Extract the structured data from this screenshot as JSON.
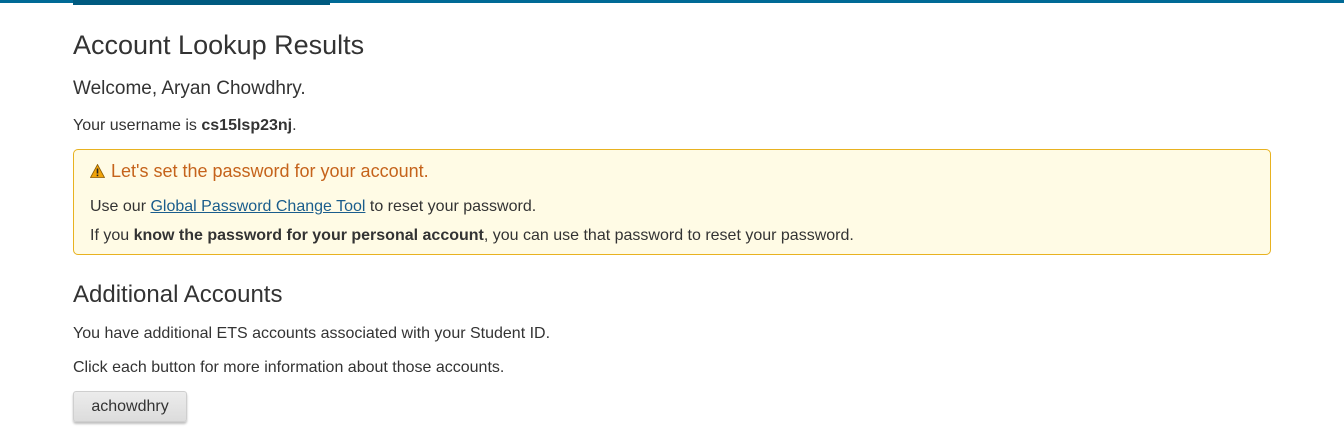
{
  "page": {
    "title": "Account Lookup Results",
    "welcome": "Welcome, Aryan Chowdhry.",
    "username_prefix": "Your username is ",
    "username": "cs15lsp23nj",
    "username_suffix": "."
  },
  "alert": {
    "icon": "warning-icon",
    "title": "Let's set the password for your account.",
    "line1_prefix": "Use our ",
    "line1_link": "Global Password Change Tool",
    "line1_suffix": " to reset your password.",
    "line2_prefix": "If you ",
    "line2_bold": "know the password for your personal account",
    "line2_suffix": ", you can use that password to reset your password.",
    "colors": {
      "background": "#fffbe5",
      "border": "#e8b220",
      "title": "#c5631b"
    }
  },
  "additional": {
    "title": "Additional Accounts",
    "para1": "You have additional ETS accounts associated with your Student ID.",
    "para2": "Click each button for more information about those accounts.",
    "accounts": [
      "achowdhry"
    ]
  },
  "colors": {
    "brand": "#006a96",
    "link": "#1a5d8c"
  }
}
